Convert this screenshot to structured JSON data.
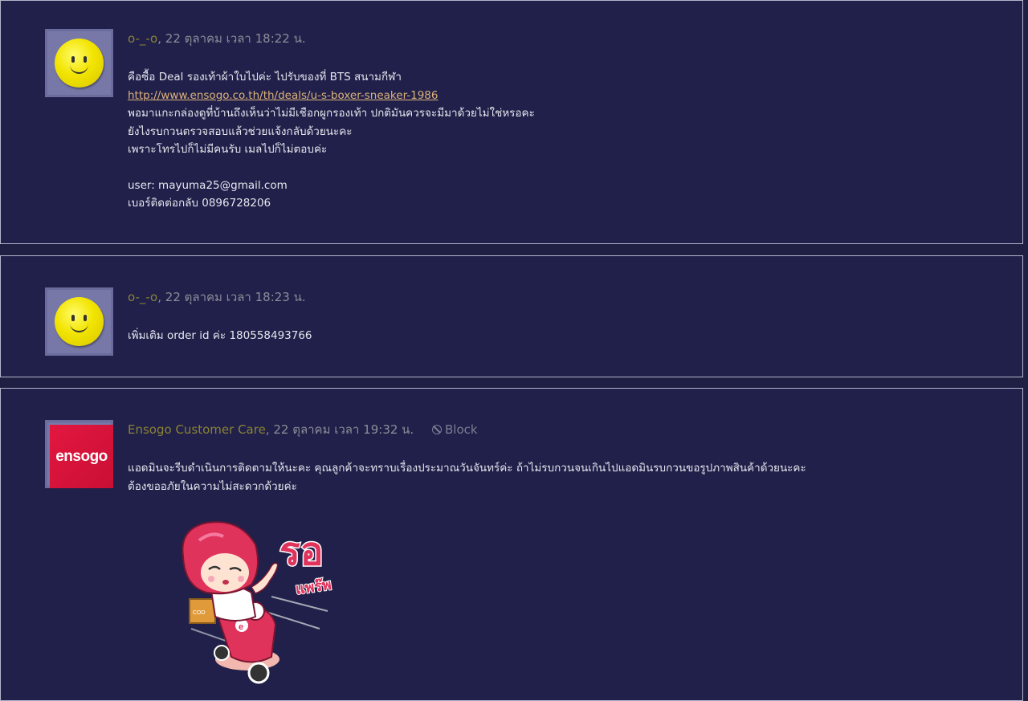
{
  "comments": [
    {
      "author": "o-_-o",
      "timestamp": ", 22 ตุลาคม เวลา 18:22 น.",
      "avatar": "smiley-avatar",
      "lines": [
        "คือซื้อ Deal รองเท้าผ้าใบไปค่ะ ไปรับของที่ BTS สนามกีฬา",
        "http://www.ensogo.co.th/th/deals/u-s-boxer-sneaker-1986",
        "พอมาแกะกล่องดูที่บ้านถึงเห็นว่าไม่มีเชือกผูกรองเท้า ปกติมันควรจะมีมาด้วยไม่ใช่หรอคะ",
        "ยังไงรบกวนตรวจสอบแล้วช่วยแจ้งกลับด้วยนะคะ",
        "เพราะโทรไปก็ไม่มีคนรับ เมลไปก็ไม่ตอบค่ะ",
        "user: mayuma25@gmail.com",
        "เบอร์ติดต่อกลับ 0896728206"
      ]
    },
    {
      "author": "o-_-o",
      "timestamp": ", 22 ตุลาคม เวลา 18:23 น.",
      "avatar": "smiley-avatar",
      "lines": [
        "เพิ่มเติม order id ค่ะ 180558493766"
      ]
    },
    {
      "author": "Ensogo Customer Care",
      "timestamp": ", 22 ตุลาคม เวลา 19:32 น.",
      "avatar_logo_text": "ensogo",
      "block_label": "Block",
      "lines": [
        "แอดมินจะรีบดำเนินการติดตามให้นะคะ คุณลูกค้าจะทราบเรื่องประมาณวันจันทร์ค่ะ ถ้าไม่รบกวนจนเกินไปแอดมินรบกวนขอรูปภาพสินค้าด้วยนะคะ",
        "ต้องขออภัยในความไม่สะดวกด้วยค่ะ"
      ],
      "sticker": {
        "text_main": "รอ",
        "text_sub": "แพร๊พ",
        "box_text": "COD"
      }
    }
  ],
  "colors": {
    "background": "#1f1f44",
    "author": "#8b8236",
    "link": "#ddb27a",
    "brand": "#e3173f"
  }
}
